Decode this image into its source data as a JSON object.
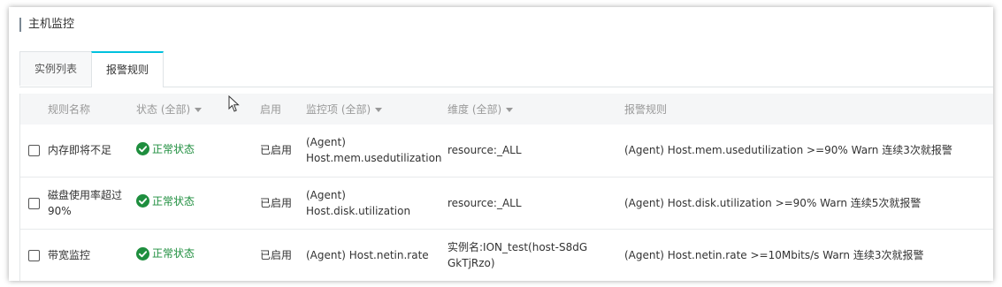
{
  "page": {
    "title": "主机监控"
  },
  "tabs": [
    {
      "label": "实例列表",
      "active": false
    },
    {
      "label": "报警规则",
      "active": true
    }
  ],
  "table": {
    "headers": {
      "name": "规则名称",
      "status": "状态 (全部)",
      "enabled": "启用",
      "metric": "监控项 (全部)",
      "dimension": "维度 (全部)",
      "rule": "报警规则"
    },
    "rows": [
      {
        "name": "内存即将不足",
        "status": "正常状态",
        "enabled": "已启用",
        "metric": "(Agent) Host.mem.usedutilization",
        "dimension": "resource:_ALL",
        "rule": "(Agent) Host.mem.usedutilization >=90% Warn 连续3次就报警"
      },
      {
        "name": "磁盘使用率超过90%",
        "status": "正常状态",
        "enabled": "已启用",
        "metric": "(Agent) Host.disk.utilization",
        "dimension": "resource:_ALL",
        "rule": "(Agent) Host.disk.utilization >=90% Warn 连续5次就报警"
      },
      {
        "name": "带宽监控",
        "status": "正常状态",
        "enabled": "已启用",
        "metric": "(Agent) Host.netin.rate",
        "dimension": "实例名:ION_test(host-S8dGGkTjRzo)",
        "rule": "(Agent) Host.netin.rate >=10Mbits/s Warn 连续3次就报警"
      }
    ]
  },
  "colors": {
    "accent": "#00c1de",
    "status_ok": "#1e8e3e"
  },
  "icons": {
    "status": "check-circle-icon",
    "cursor": "mouse-pointer-icon"
  }
}
